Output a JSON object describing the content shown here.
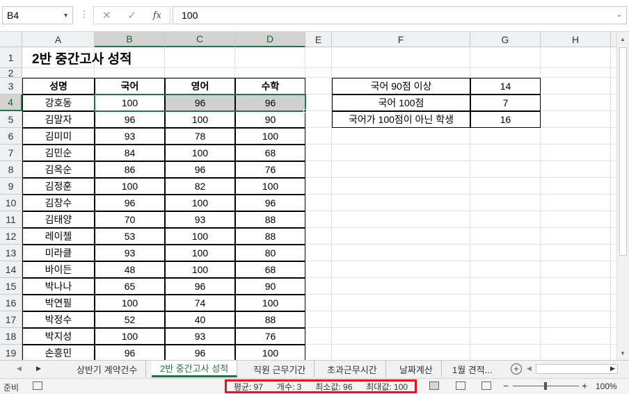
{
  "namebox": {
    "value": "B4"
  },
  "formula": {
    "value": "100",
    "fx_label": "fx"
  },
  "columns": [
    "A",
    "B",
    "C",
    "D",
    "E",
    "F",
    "G",
    "H"
  ],
  "selected_columns": [
    "B",
    "C",
    "D"
  ],
  "rows": [
    "1",
    "2",
    "3",
    "4",
    "5",
    "6",
    "7",
    "8",
    "9",
    "10",
    "11",
    "12",
    "13",
    "14",
    "15",
    "16",
    "17",
    "18",
    "19"
  ],
  "selected_row": "4",
  "sheet": {
    "title": "2반 중간고사 성적",
    "headers": [
      "성명",
      "국어",
      "영어",
      "수학"
    ],
    "students": [
      [
        "강호동",
        "100",
        "96",
        "96"
      ],
      [
        "김말자",
        "96",
        "100",
        "90"
      ],
      [
        "김미미",
        "93",
        "78",
        "100"
      ],
      [
        "김민순",
        "84",
        "100",
        "68"
      ],
      [
        "김옥순",
        "86",
        "96",
        "76"
      ],
      [
        "김정훈",
        "100",
        "82",
        "100"
      ],
      [
        "김창수",
        "96",
        "100",
        "96"
      ],
      [
        "김태양",
        "70",
        "93",
        "88"
      ],
      [
        "레이첼",
        "53",
        "100",
        "88"
      ],
      [
        "미라클",
        "93",
        "100",
        "80"
      ],
      [
        "바이든",
        "48",
        "100",
        "68"
      ],
      [
        "박나나",
        "65",
        "96",
        "90"
      ],
      [
        "박연필",
        "100",
        "74",
        "100"
      ],
      [
        "박정수",
        "52",
        "40",
        "88"
      ],
      [
        "박지성",
        "100",
        "93",
        "76"
      ],
      [
        "손흥민",
        "96",
        "96",
        "100"
      ]
    ],
    "summary": [
      [
        "국어 90점 이상",
        "14"
      ],
      [
        "국어 100점",
        "7"
      ],
      [
        "국어가 100점이 아닌 학생",
        "16"
      ]
    ]
  },
  "tabs": {
    "items": [
      "상반기 계약건수",
      "2반 중간고사 성적",
      "직원 근무기간",
      "초과근무시간",
      "날짜계산",
      "1월 견적..."
    ],
    "active_index": 1,
    "add_label": "+"
  },
  "statusbar": {
    "ready": "준비",
    "average": "평균: 97",
    "count": "개수: 3",
    "min": "최소값: 96",
    "max": "최대값: 100",
    "zoom": "100%"
  },
  "colors": {
    "accent": "#217346",
    "highlight_box": "#e8141b",
    "selected_fill": "#d0d0d0"
  }
}
